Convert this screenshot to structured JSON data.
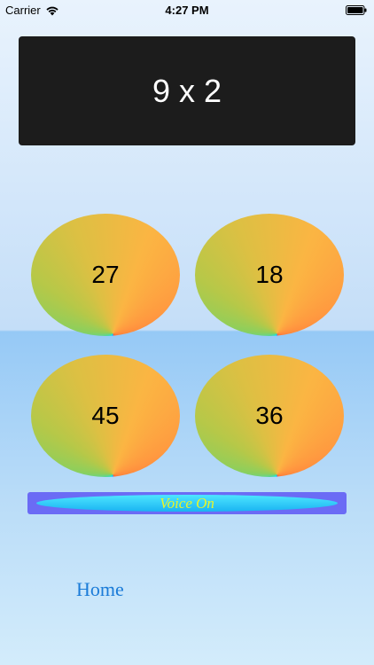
{
  "status_bar": {
    "carrier": "Carrier",
    "time": "4:27 PM",
    "wifi_icon": "wifi-icon",
    "battery_icon": "battery-icon"
  },
  "question": {
    "text": "9 x 2"
  },
  "answers": [
    {
      "label": "27"
    },
    {
      "label": "18"
    },
    {
      "label": "45"
    },
    {
      "label": "36"
    }
  ],
  "voice_button": {
    "label": "Voice On"
  },
  "home": {
    "label": "Home"
  },
  "colors": {
    "panel": "#1c1c1c",
    "voice_button": "#6b6bf5",
    "voice_text": "#e8f52a",
    "home_link": "#1a7bd8"
  }
}
